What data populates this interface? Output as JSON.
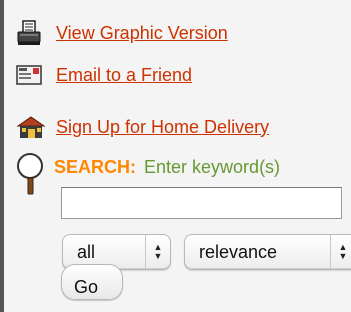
{
  "tools": {
    "graphic_version": {
      "label": "View Graphic Version",
      "icon": "printer-icon"
    },
    "email_friend": {
      "label": "Email to a Friend",
      "icon": "envelope-icon"
    },
    "home_delivery": {
      "label": "Sign Up for Home Delivery",
      "icon": "house-icon"
    }
  },
  "search": {
    "label": "SEARCH:",
    "hint": "Enter keyword(s)",
    "input_value": "",
    "scope_selected": "all",
    "sort_selected": "relevance",
    "go_label": "Go"
  },
  "colors": {
    "link": "#cc3300",
    "search_label": "#ff8800",
    "search_hint": "#669933",
    "left_border": "#555555"
  }
}
